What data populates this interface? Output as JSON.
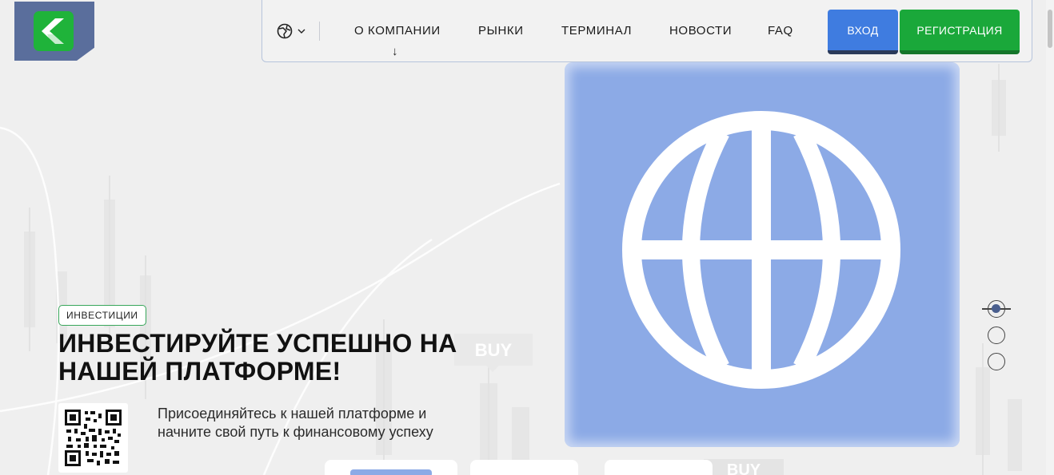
{
  "brand": {
    "logo_icon": "k-arrow-logo",
    "colors": {
      "logo_bg": "#5a6e9c",
      "logo_tile": "#1fb33a"
    }
  },
  "nav": {
    "language_icon": "globe-icon",
    "items": [
      {
        "label": "О КОМПАНИИ"
      },
      {
        "label": "РЫНКИ"
      },
      {
        "label": "ТЕРМИНАЛ"
      },
      {
        "label": "НОВОСТИ"
      },
      {
        "label": "FAQ"
      }
    ],
    "dropdown_arrow": "↓",
    "login_label": "ВХОД",
    "register_label": "РЕГИСТРАЦИЯ",
    "colors": {
      "login": "#3f7ce0",
      "register": "#1aa83a"
    }
  },
  "hero": {
    "badge": "ИНВЕСТИЦИИ",
    "headline_line1": "ИНВЕСТИРУЙТЕ УСПЕШНО НА",
    "headline_line2": "НАШЕЙ ПЛАТФОРМЕ!",
    "subtitle_line1": "Присоединяйтесь к нашей платформе и",
    "subtitle_line2": "начните свой путь к финансовому успеху",
    "image_icon": "globe-icon",
    "image_bg": "#8caae6",
    "qr_icon": "qr-code-icon"
  },
  "background": {
    "buy_label_1": "BUY",
    "buy_label_2": "BUY"
  },
  "slider": {
    "total": 3,
    "active": 1
  }
}
